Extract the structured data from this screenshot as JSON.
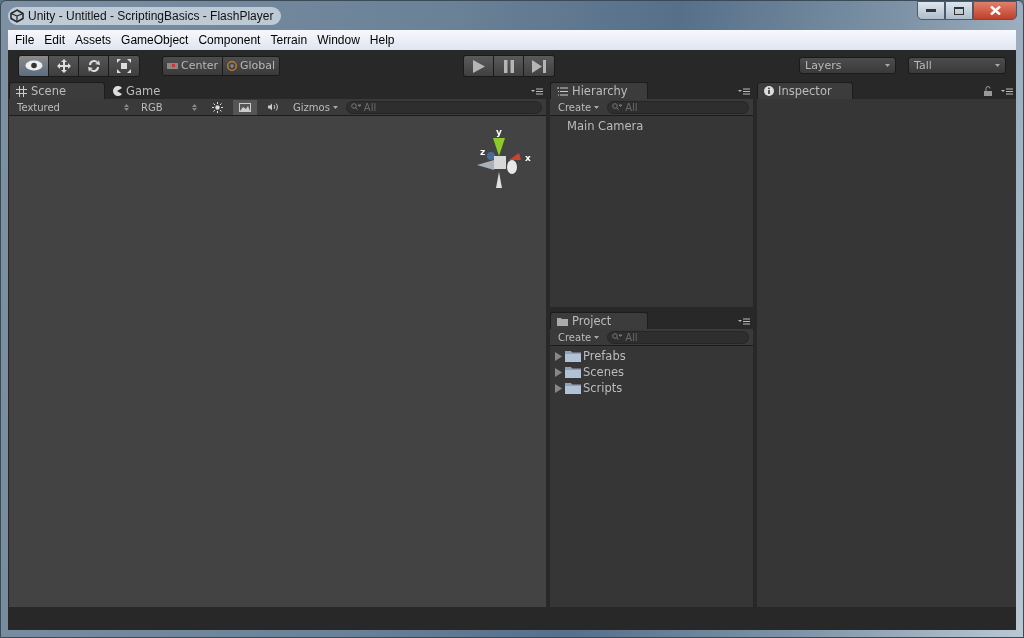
{
  "window": {
    "title": "Unity - Untitled - ScriptingBasics - FlashPlayer"
  },
  "menu": [
    "File",
    "Edit",
    "Assets",
    "GameObject",
    "Component",
    "Terrain",
    "Window",
    "Help"
  ],
  "toolbar": {
    "tools": [
      {
        "kind": "view",
        "selected": true
      },
      {
        "kind": "move",
        "selected": false
      },
      {
        "kind": "rotate",
        "selected": false
      },
      {
        "kind": "scale",
        "selected": false
      }
    ],
    "pivot": [
      {
        "kind": "pivot",
        "label": "Center"
      },
      {
        "kind": "space",
        "label": "Global"
      }
    ],
    "playback": [
      {
        "kind": "play",
        "on": false
      },
      {
        "kind": "pause",
        "on": false
      },
      {
        "kind": "step",
        "on": false
      }
    ],
    "layers": "Layers",
    "layout": "Tall"
  },
  "scene_panel": {
    "tabs": [
      {
        "kind": "scene",
        "label": "Scene",
        "selected": true
      },
      {
        "kind": "game",
        "label": "Game",
        "selected": false
      }
    ],
    "render_mode": "Textured",
    "channel": "RGB",
    "toggles": [
      {
        "kind": "lighting",
        "on": false
      },
      {
        "kind": "skybox",
        "on": true
      },
      {
        "kind": "audio",
        "on": false
      }
    ],
    "gizmos": "Gizmos",
    "search": {
      "placeholder": "All"
    },
    "gizmo_labels": {
      "y": "y",
      "z": "z",
      "x": "x"
    }
  },
  "hierarchy": {
    "tab": "Hierarchy",
    "create": "Create",
    "search": {
      "placeholder": "All"
    },
    "items": [
      "Main Camera"
    ]
  },
  "project": {
    "tab": "Project",
    "create": "Create",
    "search": {
      "placeholder": "All"
    },
    "items": [
      {
        "label": "Prefabs",
        "expanded": false
      },
      {
        "label": "Scenes",
        "expanded": false
      },
      {
        "label": "Scripts",
        "expanded": false
      }
    ]
  },
  "inspector": {
    "tab": "Inspector",
    "locked": false
  }
}
